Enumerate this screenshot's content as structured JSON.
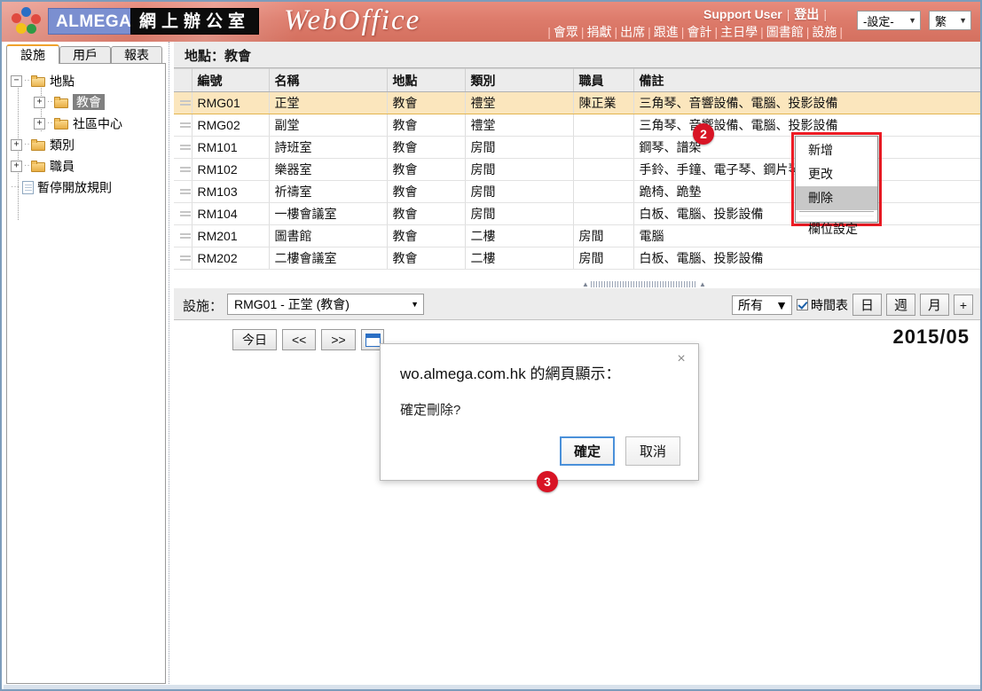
{
  "header": {
    "logo_alt": "almega-logo",
    "brand_en": "ALMEGA",
    "brand_cn": "網上辦公室",
    "product": "WebOffice",
    "user": "Support User",
    "logout": "登出",
    "sep": "|",
    "nav": [
      "會眾",
      "捐獻",
      "出席",
      "跟進",
      "會計",
      "主日學",
      "圖書館",
      "設施"
    ],
    "settings_select": "-設定-",
    "lang_select": "繁",
    "arrow": "▼"
  },
  "sidebar": {
    "tabs": [
      {
        "label": "設施",
        "active": true
      },
      {
        "label": "用戶",
        "active": false
      },
      {
        "label": "報表",
        "active": false
      }
    ],
    "tree": [
      {
        "label": "地點",
        "expander": "−",
        "selected": false
      },
      {
        "label": "教會",
        "expander": "+",
        "selected": true
      },
      {
        "label": "社區中心",
        "expander": "+",
        "selected": false
      },
      {
        "label": "類別",
        "expander": "+",
        "selected": false
      },
      {
        "label": "職員",
        "expander": "+",
        "selected": false
      },
      {
        "label": "暫停開放規則",
        "expander": "",
        "selected": false
      }
    ]
  },
  "main": {
    "breadcrumb": "地點：教會",
    "grid": {
      "columns": [
        "編號",
        "名稱",
        "地點",
        "類別",
        "職員",
        "備註"
      ],
      "rows": [
        {
          "code": "RMG01",
          "name": "正堂",
          "site": "教會",
          "category": "禮堂",
          "staff": "陳正業",
          "remark": "三角琴、音響設備、電腦、投影設備",
          "selected": true
        },
        {
          "code": "RMG02",
          "name": "副堂",
          "site": "教會",
          "category": "禮堂",
          "staff": "",
          "remark": "三角琴、音響設備、電腦、投影設備",
          "selected": false
        },
        {
          "code": "RM101",
          "name": "詩班室",
          "site": "教會",
          "category": "房間",
          "staff": "",
          "remark": "鋼琴、譜架",
          "selected": false
        },
        {
          "code": "RM102",
          "name": "樂器室",
          "site": "教會",
          "category": "房間",
          "staff": "",
          "remark": "手鈴、手鐘、電子琴、鋼片琴、木片琴",
          "selected": false
        },
        {
          "code": "RM103",
          "name": "祈禱室",
          "site": "教會",
          "category": "房間",
          "staff": "",
          "remark": "跪椅、跪墊",
          "selected": false
        },
        {
          "code": "RM104",
          "name": "一樓會議室",
          "site": "教會",
          "category": "房間",
          "staff": "",
          "remark": "白板、電腦、投影設備",
          "selected": false
        },
        {
          "code": "RM201",
          "name": "圖書館",
          "site": "教會",
          "category": "二樓",
          "staff": "房間",
          "remark": "電腦",
          "selected": false
        },
        {
          "code": "RM202",
          "name": "二樓會議室",
          "site": "教會",
          "category": "二樓",
          "staff": "房間",
          "remark": "白板、電腦、投影設備",
          "selected": false
        }
      ]
    },
    "context_menu": {
      "items": [
        {
          "label": "新增",
          "highlighted": false
        },
        {
          "label": "更改",
          "highlighted": false
        },
        {
          "label": "刪除",
          "highlighted": true
        },
        {
          "label": "欄位設定",
          "highlighted": false
        }
      ]
    },
    "toolbar": {
      "label": "設施：",
      "facility_value": "RMG01 - 正堂 (教會)",
      "filter_value": "所有",
      "schedule_label": "時間表",
      "views": [
        "日",
        "週",
        "月",
        "+"
      ],
      "arrow": "▼"
    },
    "calendar": {
      "today_button": "今日",
      "prev_button": "<<",
      "next_button": ">>",
      "picker_icon": "calendar-icon",
      "year_month": "2015/05"
    }
  },
  "dialog": {
    "title": "wo.almega.com.hk 的網頁顯示：",
    "message": "確定刪除?",
    "confirm": "確定",
    "cancel": "取消",
    "close": "×"
  },
  "annotations": [
    {
      "id": "2",
      "label": "2"
    },
    {
      "id": "3",
      "label": "3"
    }
  ],
  "colors": {
    "header_red": "#dd7b6b",
    "badge_red": "#d81425",
    "selected_row": "#fbe6bd",
    "highlight_outline": "#ee1c25",
    "primary_button_border": "#4a90d9"
  }
}
